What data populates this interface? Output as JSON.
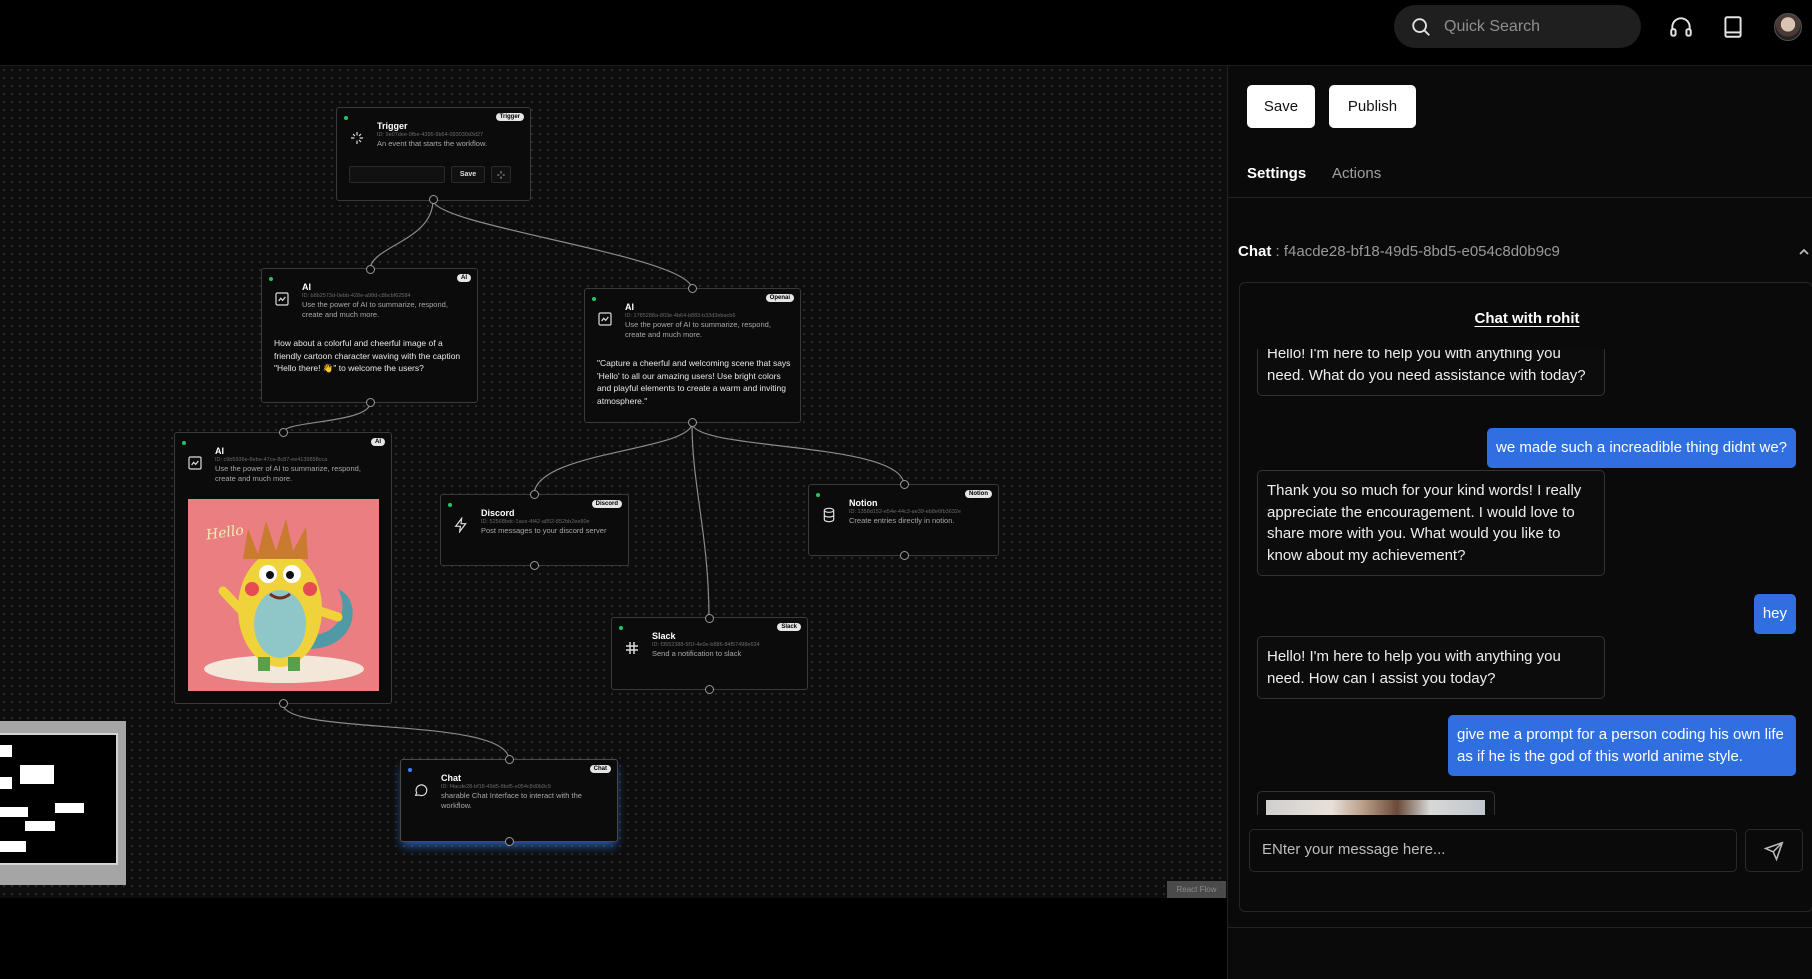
{
  "topbar": {
    "search_placeholder": "Quick Search",
    "icons": [
      "search-icon",
      "headphones-icon",
      "book-icon",
      "avatar"
    ]
  },
  "canvas": {
    "nodes": {
      "trigger": {
        "title": "Trigger",
        "badge": "Trigger",
        "id": "ID: 9e07dee-9fbe-4395-9b64-093030d3d27",
        "desc": "An event that starts the workflow.",
        "save_label": "Save"
      },
      "ai1": {
        "title": "AI",
        "badge": "AI",
        "id": "ID: b8b2573d-0ebb-428e-a98d-c8bcbf62584",
        "desc": "Use the power of AI to summarize, respond, create and much more.",
        "text": "How about a colorful and cheerful image of a friendly cartoon character waving with the caption \"Hello there! 👋\" to welcome the users?"
      },
      "ai2": {
        "title": "AI",
        "badge": "Openai",
        "id": "ID: 1785288a-803e-4b64-b883-b33d3ebacb6",
        "desc": "Use the power of AI to summarize, respond, create and much more.",
        "text": "\"Capture a cheerful and welcoming scene that says 'Hello' to all our amazing users! Use bright colors and playful elements to create a warm and inviting atmosphere.\""
      },
      "ai3": {
        "title": "AI",
        "badge": "AI",
        "id": "ID: c9b5936e-8ebe-47ce-8c87-ee4139898cca",
        "desc": "Use the power of AI to summarize, respond, create and much more.",
        "image_text": "Hello"
      },
      "discord": {
        "title": "Discord",
        "badge": "Discord",
        "id": "ID: 52568bdc-1ace-4f42-a852-852bb2ee80e",
        "desc": "Post messages to your discord server"
      },
      "notion": {
        "title": "Notion",
        "badge": "Notion",
        "id": "ID: 1358d152-e54e-44c3-ae39-eb8e6fb3632e",
        "desc": "Create entries directly in notion."
      },
      "slack": {
        "title": "Slack",
        "badge": "Slack",
        "id": "ID: f3552388-5f1f-4e0e-b886-84f57498e634",
        "desc": "Send a notification to slack"
      },
      "chat": {
        "title": "Chat",
        "badge": "Chat",
        "id": "ID: f4acde28-bf18-49d5-8bd5-e054c8d0b9c9",
        "desc": "sharable Chat Interface to interact with the workflow."
      }
    },
    "attribution": "React Flow"
  },
  "panel": {
    "save_label": "Save",
    "publish_label": "Publish",
    "tabs": [
      "Settings",
      "Actions"
    ],
    "active_tab": "Settings",
    "chat_label": "Chat",
    "chat_id": " : f4acde28-bf18-49d5-8bd5-e054c8d0b9c9",
    "chat_title": "Chat with rohit",
    "messages": [
      {
        "role": "bot",
        "text": "Hello! I'm here to help you with anything you need. What do you need assistance with today?"
      },
      {
        "role": "user",
        "text": "we made such a increadible thing didnt we?"
      },
      {
        "role": "bot",
        "text": "Thank you so much for your kind words! I really appreciate the encouragement. I would love to share more with you. What would you like to know about my achievement?"
      },
      {
        "role": "user",
        "text": "hey"
      },
      {
        "role": "bot",
        "text": "Hello! I'm here to help you with anything you need. How can I assist you today?"
      },
      {
        "role": "user",
        "text": "give me a prompt for a person coding his own life as if he is the god of this world anime style."
      }
    ],
    "input_placeholder": "ENter your message here..."
  }
}
